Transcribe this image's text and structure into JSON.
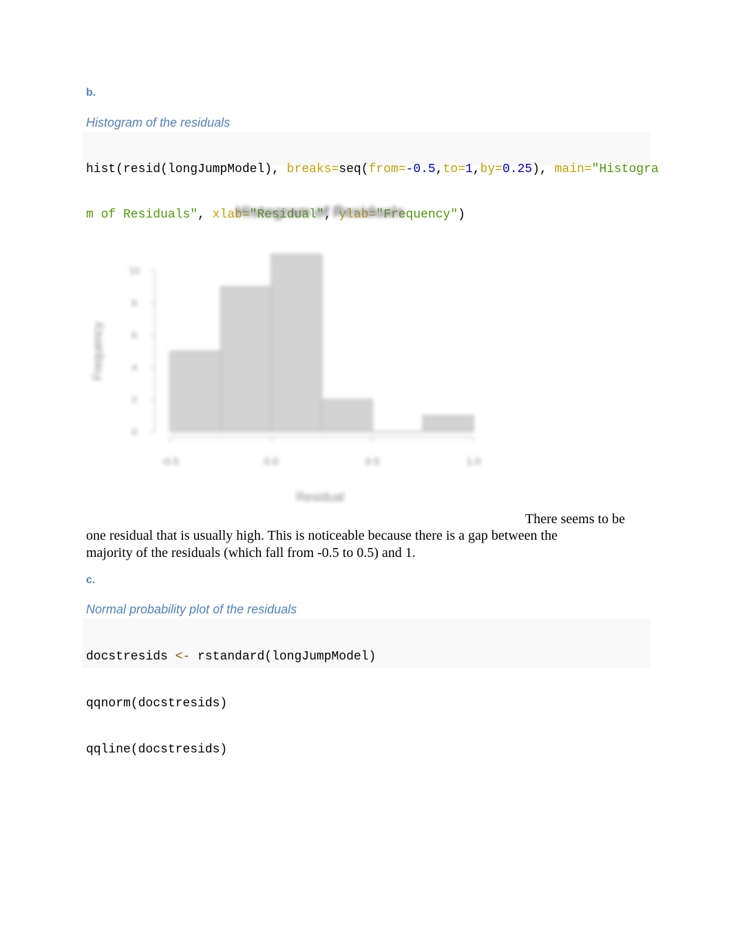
{
  "section_b": {
    "label": "b.",
    "caption": "Histogram of the residuals",
    "code": {
      "line1": [
        {
          "t": "plain",
          "s": "hist(resid(longJumpModel), "
        },
        {
          "t": "arg",
          "s": "breaks="
        },
        {
          "t": "plain",
          "s": "seq("
        },
        {
          "t": "arg",
          "s": "from="
        },
        {
          "t": "num",
          "s": "-0.5"
        },
        {
          "t": "plain",
          "s": ","
        },
        {
          "t": "arg",
          "s": "to="
        },
        {
          "t": "num",
          "s": "1"
        },
        {
          "t": "plain",
          "s": ","
        },
        {
          "t": "arg",
          "s": "by="
        },
        {
          "t": "num",
          "s": "0.25"
        },
        {
          "t": "plain",
          "s": "), "
        },
        {
          "t": "arg",
          "s": "main="
        },
        {
          "t": "str",
          "s": "\"Histogra"
        }
      ],
      "line2": [
        {
          "t": "str",
          "s": "m of Residuals\""
        },
        {
          "t": "plain",
          "s": ", "
        },
        {
          "t": "arg",
          "s": "xlab="
        },
        {
          "t": "str",
          "s": "\"Residual\""
        },
        {
          "t": "plain",
          "s": ", "
        },
        {
          "t": "arg",
          "s": "ylab="
        },
        {
          "t": "str",
          "s": "\"Frequency\""
        },
        {
          "t": "plain",
          "s": ")"
        }
      ]
    },
    "paragraph_lead": "There seems to be",
    "paragraph_line2": "one residual that is usually high. This is noticeable because there is a gap between the",
    "paragraph_line3": "majority of the residuals (which fall from -0.5 to 0.5) and 1."
  },
  "section_c": {
    "label": "c.",
    "caption": "Normal probability plot of the residuals",
    "code": {
      "line1": [
        {
          "t": "plain",
          "s": "docstresids "
        },
        {
          "t": "op",
          "s": "<-"
        },
        {
          "t": "plain",
          "s": " rstandard(longJumpModel)"
        }
      ],
      "line2": [
        {
          "t": "plain",
          "s": "qqnorm(docstresids)"
        }
      ],
      "line3": [
        {
          "t": "plain",
          "s": "qqline(docstresids)"
        }
      ]
    }
  },
  "colors": {
    "heading": "#4f81bd",
    "code_arg": "#c4a000",
    "code_number": "#0000cf",
    "code_string": "#4e9a06",
    "code_operator": "#8f5902",
    "bar_fill": "#d3d3d3"
  },
  "chart_data": {
    "type": "bar",
    "title": "Histogram of Residuals",
    "xlabel": "Residual",
    "ylabel": "Frequency",
    "bins": [
      [
        -0.5,
        -0.25
      ],
      [
        -0.25,
        0.0
      ],
      [
        0.0,
        0.25
      ],
      [
        0.25,
        0.5
      ],
      [
        0.5,
        0.75
      ],
      [
        0.75,
        1.0
      ]
    ],
    "categories": [
      "-0.5–-0.25",
      "-0.25–0",
      "0–0.25",
      "0.25–0.5",
      "0.5–0.75",
      "0.75–1"
    ],
    "values": [
      5,
      9,
      11,
      2,
      0,
      1
    ],
    "xlim": [
      -0.5,
      1.0
    ],
    "ylim": [
      0,
      11
    ],
    "xticks": [
      -0.5,
      0.0,
      0.5,
      1.0
    ],
    "xtick_labels": [
      "-0.5",
      "0.0",
      "0.5",
      "1.0"
    ],
    "yticks": [
      0,
      2,
      4,
      6,
      8,
      10
    ],
    "ytick_labels": [
      "0",
      "2",
      "4",
      "6",
      "8",
      "10"
    ],
    "grid": false,
    "legend": "none",
    "note": "image rendered blurred in source"
  }
}
